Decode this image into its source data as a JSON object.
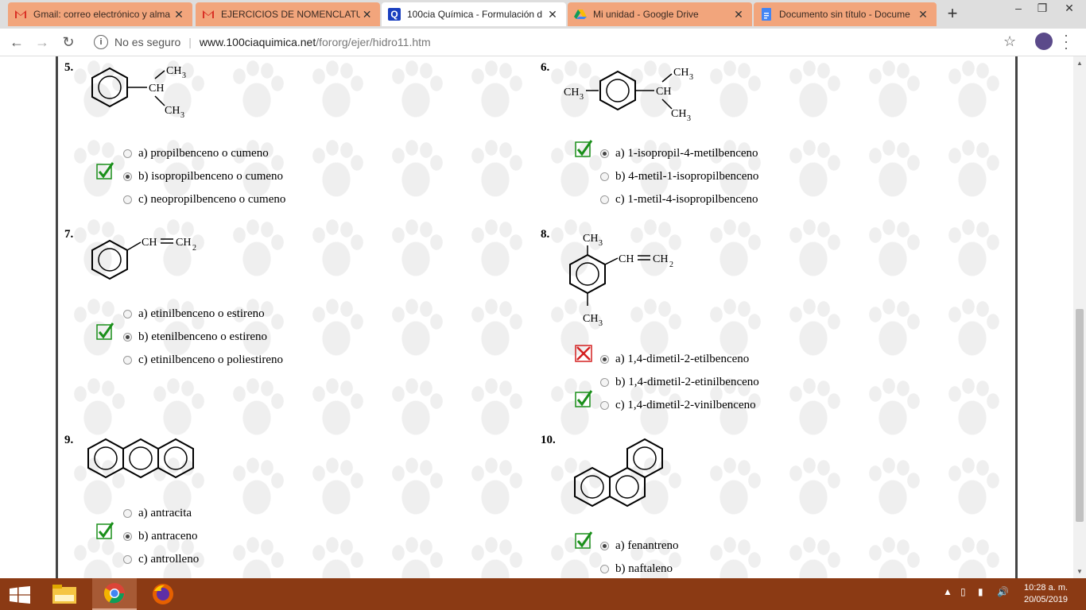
{
  "browser": {
    "tabs": [
      {
        "title": "Gmail: correo electrónico y alma",
        "icon": "gmail-icon"
      },
      {
        "title": "EJERCICIOS DE NOMENCLATUR",
        "icon": "gmail-icon"
      },
      {
        "title": "100cia Química - Formulación d",
        "icon": "q-icon",
        "active": true
      },
      {
        "title": "Mi unidad - Google Drive",
        "icon": "drive-icon"
      },
      {
        "title": "Documento sin título - Docume",
        "icon": "docs-icon"
      }
    ],
    "new_tab": "+",
    "security_label": "No es seguro",
    "url_host": "www.100ciaquimica.net",
    "url_path": "/fororg/ejer/hidro11.htm"
  },
  "questions": [
    {
      "number": "5.",
      "options": [
        {
          "label": "a) propilbenceno o cumeno",
          "selected": false
        },
        {
          "label": "b) isopropilbenceno o cumeno",
          "selected": true
        },
        {
          "label": "c) neopropilbenceno o cumeno",
          "selected": false
        }
      ],
      "marks": [
        {
          "option": 1,
          "type": "correct"
        }
      ],
      "structure_labels": [
        "CH3",
        "CH",
        "CH3"
      ]
    },
    {
      "number": "6.",
      "options": [
        {
          "label": "a) 1-isopropil-4-metilbenceno",
          "selected": true
        },
        {
          "label": "b) 4-metil-1-isopropilbenceno",
          "selected": false
        },
        {
          "label": "c) 1-metil-4-isopropilbenceno",
          "selected": false
        }
      ],
      "marks": [
        {
          "option": 0,
          "type": "correct"
        }
      ],
      "structure_labels": [
        "CH3",
        "CH3",
        "CH",
        "CH3"
      ]
    },
    {
      "number": "7.",
      "options": [
        {
          "label": "a) etinilbenceno o estireno",
          "selected": false
        },
        {
          "label": "b) etenilbenceno o estireno",
          "selected": true
        },
        {
          "label": "c) etinilbenceno o poliestireno",
          "selected": false
        }
      ],
      "marks": [
        {
          "option": 1,
          "type": "correct"
        }
      ],
      "structure_labels": [
        "CH",
        "CH2"
      ]
    },
    {
      "number": "8.",
      "options": [
        {
          "label": "a) 1,4-dimetil-2-etilbenceno",
          "selected": true
        },
        {
          "label": "b) 1,4-dimetil-2-etinilbenceno",
          "selected": false
        },
        {
          "label": "c) 1,4-dimetil-2-vinilbenceno",
          "selected": false
        }
      ],
      "marks": [
        {
          "option": 0,
          "type": "wrong"
        },
        {
          "option": 2,
          "type": "correct"
        }
      ],
      "structure_labels": [
        "CH3",
        "CH",
        "CH2",
        "CH3"
      ]
    },
    {
      "number": "9.",
      "options": [
        {
          "label": "a) antracita",
          "selected": false
        },
        {
          "label": "b) antraceno",
          "selected": true
        },
        {
          "label": "c) antrolleno",
          "selected": false
        }
      ],
      "marks": [
        {
          "option": 1,
          "type": "correct"
        }
      ]
    },
    {
      "number": "10.",
      "options": [
        {
          "label": "a) fenantreno",
          "selected": true
        },
        {
          "label": "b) naftaleno",
          "selected": false
        }
      ],
      "marks": [
        {
          "option": 0,
          "type": "correct"
        }
      ]
    }
  ],
  "taskbar": {
    "apps": [
      "file-explorer-icon",
      "chrome-icon",
      "firefox-icon"
    ],
    "time": "10:28 a. m.",
    "date": "20/05/2019"
  },
  "colors": {
    "tab_inactive": "#f2a57c",
    "taskbar": "#8b3a14",
    "check_green": "#1a8f1a",
    "cross_red": "#d42020"
  }
}
